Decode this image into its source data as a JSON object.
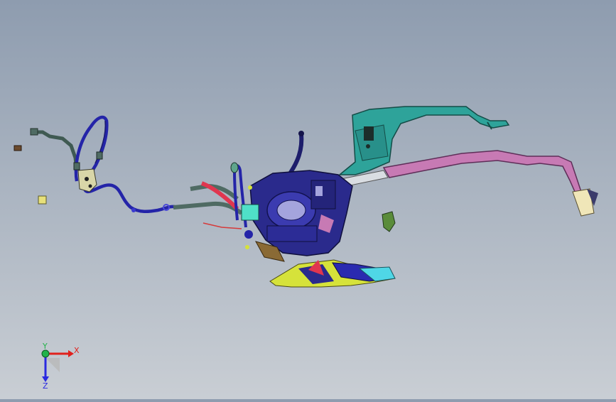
{
  "viewport": {
    "background_top": "#8e9caf",
    "background_bottom": "#c9ced4"
  },
  "model": {
    "parts": [
      "blower-housing",
      "teal-duct",
      "pink-duct",
      "blue-hose",
      "gray-hose",
      "red-hose",
      "floor-duct",
      "small-bracket",
      "connector"
    ],
    "colors": {
      "navy": "#2a2a8c",
      "blue": "#2b2bb8",
      "teal": "#2ea39a",
      "pink": "#c77ab4",
      "gray_green": "#4f6b63",
      "red": "#e0364f",
      "yellow": "#d6e23a",
      "cyan": "#4fd7e6",
      "brown": "#8a6a35",
      "lavender": "#a4a4dd"
    }
  },
  "triad": {
    "x_label": "X",
    "y_label": "Y",
    "z_label": "Z",
    "x_color": "#e0211d",
    "y_color": "#22b34a",
    "z_color": "#2a2ae0"
  }
}
